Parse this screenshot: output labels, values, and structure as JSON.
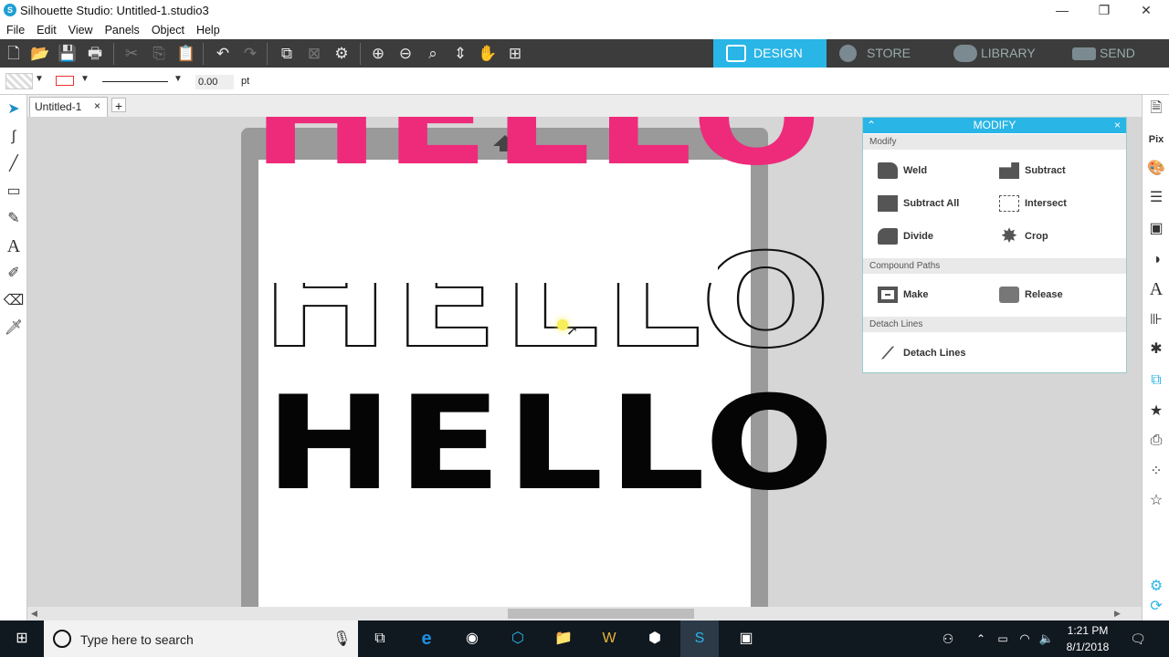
{
  "window": {
    "title": "Silhouette Studio: Untitled-1.studio3",
    "minimize": "—",
    "maximize": "❐",
    "close": "✕"
  },
  "menu": [
    "File",
    "Edit",
    "View",
    "Panels",
    "Object",
    "Help"
  ],
  "nav_tabs": {
    "design": "DESIGN",
    "store": "STORE",
    "library": "LIBRARY",
    "send": "SEND"
  },
  "props": {
    "line_width": "0.00",
    "unit": "pt"
  },
  "doc_tab": {
    "label": "Untitled-1",
    "close": "×",
    "add": "+"
  },
  "canvas": {
    "word": "HELLO",
    "colors": {
      "pink": "#ee2a7b",
      "black": "#050505"
    }
  },
  "modify_panel": {
    "title": "MODIFY",
    "close": "×",
    "sections": {
      "modify": "Modify",
      "compound": "Compound Paths",
      "detach": "Detach Lines"
    },
    "buttons": {
      "weld": "Weld",
      "subtract": "Subtract",
      "subtract_all": "Subtract All",
      "intersect": "Intersect",
      "divide": "Divide",
      "crop": "Crop",
      "make": "Make",
      "release": "Release",
      "detach_lines": "Detach Lines"
    }
  },
  "taskbar": {
    "search_placeholder": "Type here to search",
    "time": "1:21 PM",
    "date": "8/1/2018"
  },
  "accent": "#29b5e6"
}
